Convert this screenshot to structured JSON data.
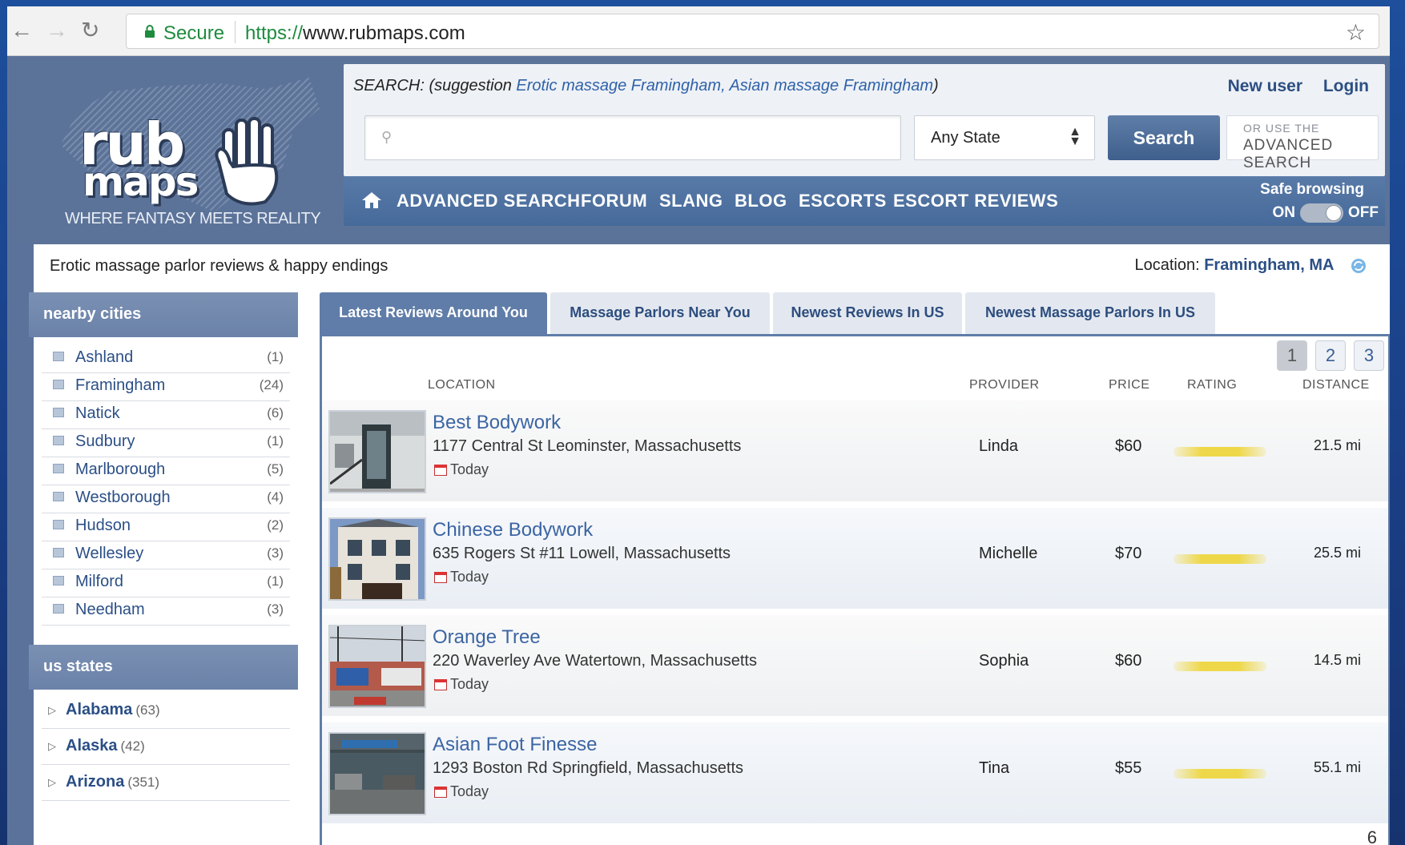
{
  "browser": {
    "secure_label": "Secure",
    "url_protocol": "https://",
    "url_host": "www.rubmaps.com"
  },
  "logo": {
    "line1": "rub",
    "line2": "maps",
    "tagline": "WHERE FANTASY MEETS REALITY"
  },
  "search": {
    "prefix": "SEARCH: (suggestion ",
    "suggestion": "Erotic massage Framingham, Asian massage Framingham",
    "suffix": ")",
    "input_value": "",
    "state_select": "Any State",
    "button": "Search",
    "advanced_small": "OR USE THE",
    "advanced_big": "ADVANCED SEARCH"
  },
  "header_links": {
    "new_user": "New user",
    "login": "Login"
  },
  "nav": {
    "items": [
      "ADVANCED SEARCH",
      "FORUM",
      "SLANG",
      "BLOG",
      "ESCORTS",
      "ESCORT REVIEWS"
    ],
    "safe_browsing_label": "Safe browsing",
    "toggle_on": "ON",
    "toggle_off": "OFF"
  },
  "page": {
    "tagline": "Erotic massage parlor reviews & happy endings",
    "location_label": "Location:",
    "location_value": "Framingham, MA"
  },
  "sidebar": {
    "nearby_title": "nearby cities",
    "cities": [
      {
        "name": "Ashland",
        "count": "(1)"
      },
      {
        "name": "Framingham",
        "count": "(24)"
      },
      {
        "name": "Natick",
        "count": "(6)"
      },
      {
        "name": "Sudbury",
        "count": "(1)"
      },
      {
        "name": "Marlborough",
        "count": "(5)"
      },
      {
        "name": "Westborough",
        "count": "(4)"
      },
      {
        "name": "Hudson",
        "count": "(2)"
      },
      {
        "name": "Wellesley",
        "count": "(3)"
      },
      {
        "name": "Milford",
        "count": "(1)"
      },
      {
        "name": "Needham",
        "count": "(3)"
      }
    ],
    "states_title": "us states",
    "states": [
      {
        "name": "Alabama",
        "count": "(63)"
      },
      {
        "name": "Alaska",
        "count": "(42)"
      },
      {
        "name": "Arizona",
        "count": "(351)"
      }
    ]
  },
  "tabs": [
    "Latest Reviews Around You",
    "Massage Parlors Near You",
    "Newest Reviews In US",
    "Newest Massage Parlors In US"
  ],
  "pagination": [
    "1",
    "2",
    "3"
  ],
  "columns": {
    "location": "LOCATION",
    "provider": "PROVIDER",
    "price": "PRICE",
    "rating": "RATING",
    "distance": "DISTANCE"
  },
  "reviews": [
    {
      "title": "Best Bodywork",
      "address": "1177 Central St Leominster, Massachusetts",
      "date": "Today",
      "provider": "Linda",
      "price": "$60",
      "distance": "21.5 mi"
    },
    {
      "title": "Chinese Bodywork",
      "address": "635 Rogers St #11 Lowell, Massachusetts",
      "date": "Today",
      "provider": "Michelle",
      "price": "$70",
      "distance": "25.5 mi"
    },
    {
      "title": "Orange Tree",
      "address": "220 Waverley Ave Watertown, Massachusetts",
      "date": "Today",
      "provider": "Sophia",
      "price": "$60",
      "distance": "14.5 mi"
    },
    {
      "title": "Asian Foot Finesse",
      "address": "1293 Boston Rd Springfield, Massachusetts",
      "date": "Today",
      "provider": "Tina",
      "price": "$55",
      "distance": "55.1 mi"
    }
  ],
  "slide_number": "6",
  "colors": {
    "accent": "#5f7da8",
    "link": "#2b4f86",
    "secure_green": "#1e8b3e",
    "rating_yellow": "#eed84a"
  }
}
